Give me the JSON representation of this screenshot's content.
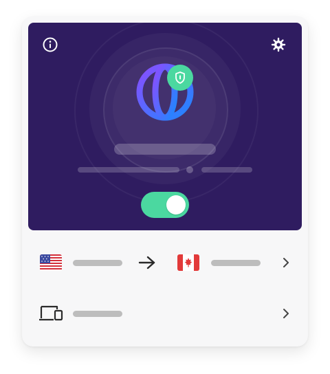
{
  "theme": {
    "hero_background": "#2f1c60",
    "accent_green": "#4bd8a0",
    "globe_gradient": [
      "#8a4dff",
      "#1e88ff"
    ]
  },
  "header": {
    "info_icon": "info-circle-icon",
    "settings_icon": "gear-icon"
  },
  "status": {
    "icon": "globe-with-shield-icon",
    "title_placeholder": "",
    "detail_placeholder": "",
    "vpn_toggle_on": true
  },
  "connection": {
    "from_country_flag": "us-flag",
    "to_country_flag": "ca-flag",
    "separator_icon": "arrow-right-icon",
    "from_label": "",
    "to_label": "",
    "chevron_icon": "chevron-right-icon"
  },
  "devices": {
    "icon": "devices-icon",
    "label": "",
    "chevron_icon": "chevron-right-icon"
  }
}
